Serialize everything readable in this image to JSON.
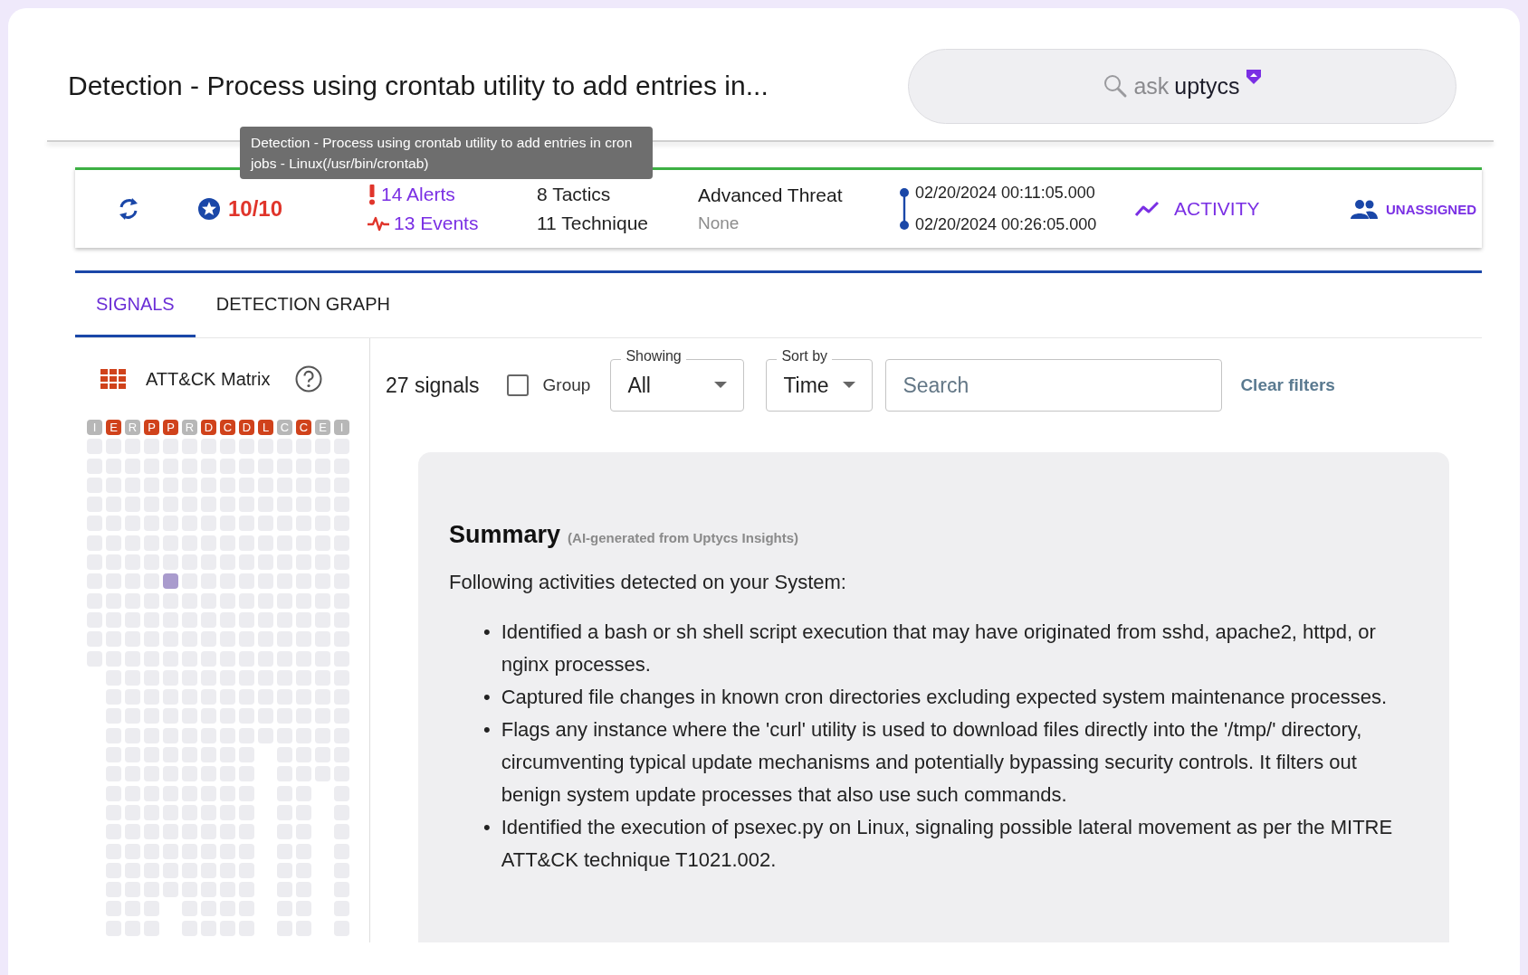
{
  "title": "Detection - Process using crontab utility to add entries in...",
  "ask": {
    "prompt": "ask",
    "brand": "uptycs"
  },
  "tooltip": "Detection - Process using crontab utility to add entries in cron jobs - Linux(/usr/bin/crontab)",
  "stats": {
    "score": "10/10",
    "alerts": "14 Alerts",
    "events": "13 Events",
    "tactics": "8 Tactics",
    "techniques": "11 Technique",
    "threat": "Advanced Threat",
    "threat_detail": "None",
    "start_time": "02/20/2024 00:11:05.000",
    "end_time": "02/20/2024 00:26:05.000",
    "activity": "ACTIVITY",
    "assignment": "UNASSIGNED"
  },
  "tabs": [
    {
      "label": "SIGNALS",
      "selected": true
    },
    {
      "label": "DETECTION GRAPH",
      "selected": false
    }
  ],
  "matrix": {
    "title": "ATT&CK Matrix",
    "columns": [
      {
        "letter": "I",
        "active": false,
        "cells": [
          false,
          false,
          false,
          false,
          false,
          false,
          false,
          false,
          false,
          false,
          false,
          false
        ]
      },
      {
        "letter": "E",
        "active": true,
        "cells": [
          false,
          false,
          false,
          false,
          false,
          false,
          false,
          false,
          false,
          false,
          false,
          false,
          false,
          false,
          false,
          false,
          false,
          false,
          false,
          false,
          false,
          false,
          false,
          false,
          false,
          false
        ]
      },
      {
        "letter": "R",
        "active": false,
        "cells": [
          false,
          false,
          false,
          false,
          false,
          false,
          false,
          false,
          false,
          false,
          false,
          false,
          false,
          false,
          false,
          false,
          false,
          false,
          false,
          false,
          false,
          false,
          false,
          false,
          false,
          false
        ]
      },
      {
        "letter": "P",
        "active": true,
        "cells": [
          false,
          false,
          false,
          false,
          false,
          false,
          false,
          false,
          false,
          false,
          false,
          false,
          false,
          false,
          false,
          false,
          false,
          false,
          false,
          false,
          false,
          false,
          false,
          false,
          false,
          false
        ]
      },
      {
        "letter": "P",
        "active": true,
        "cells": [
          false,
          false,
          false,
          false,
          false,
          false,
          false,
          true,
          false,
          false,
          false,
          false,
          false,
          false,
          false,
          false,
          false,
          false,
          false,
          false,
          false,
          false,
          false,
          false
        ]
      },
      {
        "letter": "R",
        "active": false,
        "cells": [
          false,
          false,
          false,
          false,
          false,
          false,
          false,
          false,
          false,
          false,
          false,
          false,
          false,
          false,
          false,
          false,
          false,
          false,
          false,
          false,
          false,
          false,
          false,
          false,
          false,
          false
        ]
      },
      {
        "letter": "D",
        "active": true,
        "cells": [
          false,
          false,
          false,
          false,
          false,
          false,
          false,
          false,
          false,
          false,
          false,
          false,
          false,
          false,
          false,
          false,
          false,
          false,
          false,
          false,
          false,
          false,
          false,
          false,
          false,
          false
        ]
      },
      {
        "letter": "C",
        "active": true,
        "cells": [
          false,
          false,
          false,
          false,
          false,
          false,
          false,
          false,
          false,
          false,
          false,
          false,
          false,
          false,
          false,
          false,
          false,
          false,
          false,
          false,
          false,
          false,
          false,
          false,
          false,
          false
        ]
      },
      {
        "letter": "D",
        "active": true,
        "cells": [
          false,
          false,
          false,
          false,
          false,
          false,
          false,
          false,
          false,
          false,
          false,
          false,
          false,
          false,
          false,
          false,
          false,
          false,
          false,
          false,
          false,
          false,
          false,
          false,
          false,
          false
        ]
      },
      {
        "letter": "L",
        "active": true,
        "cells": [
          false,
          false,
          false,
          false,
          false,
          false,
          false,
          false,
          false,
          false,
          false,
          false,
          false,
          false,
          false,
          false
        ]
      },
      {
        "letter": "C",
        "active": false,
        "cells": [
          false,
          false,
          false,
          false,
          false,
          false,
          false,
          false,
          false,
          false,
          false,
          false,
          false,
          false,
          false,
          false,
          false,
          false,
          false,
          false,
          false,
          false,
          false,
          false,
          false,
          false
        ]
      },
      {
        "letter": "C",
        "active": true,
        "cells": [
          false,
          false,
          false,
          false,
          false,
          false,
          false,
          false,
          false,
          false,
          false,
          false,
          false,
          false,
          false,
          false,
          false,
          false,
          false,
          false,
          false,
          false,
          false,
          false,
          false,
          false
        ]
      },
      {
        "letter": "E",
        "active": false,
        "cells": [
          false,
          false,
          false,
          false,
          false,
          false,
          false,
          false,
          false,
          false,
          false,
          false,
          false,
          false,
          false,
          false,
          false,
          false
        ]
      },
      {
        "letter": "I",
        "active": false,
        "cells": [
          false,
          false,
          false,
          false,
          false,
          false,
          false,
          false,
          false,
          false,
          false,
          false,
          false,
          false,
          false,
          false,
          false,
          false,
          false,
          false,
          false,
          false,
          false,
          false,
          false,
          false
        ]
      }
    ]
  },
  "filters": {
    "count": "27 signals",
    "group": {
      "label": "Group",
      "checked": false
    },
    "showing": {
      "label": "Showing",
      "value": "All"
    },
    "sort": {
      "label": "Sort by",
      "value": "Time"
    },
    "search": {
      "placeholder": "Search"
    },
    "clear": "Clear filters"
  },
  "summary": {
    "title": "Summary",
    "subtitle": "(AI-generated from Uptycs Insights)",
    "intro": "Following activities detected on your System:",
    "bullets": [
      {
        "marker": "•",
        "text": "Identified a bash or sh shell script execution that may have originated from sshd, apache2, httpd, or nginx processes."
      },
      {
        "marker": "•",
        "text": "Captured file changes in known cron directories excluding expected system maintenance processes."
      },
      {
        "marker": "•",
        "text": "Flags any instance where the 'curl' utility is used to download files directly into the '/tmp/' directory, circumventing typical update mechanisms and potentially bypassing security controls. It filters out benign system update processes that also use such commands."
      },
      {
        "marker": "•",
        "text": "Identified the execution of psexec.py on Linux, signaling possible lateral movement as per the MITRE ATT&CK technique T1021.002."
      }
    ]
  }
}
